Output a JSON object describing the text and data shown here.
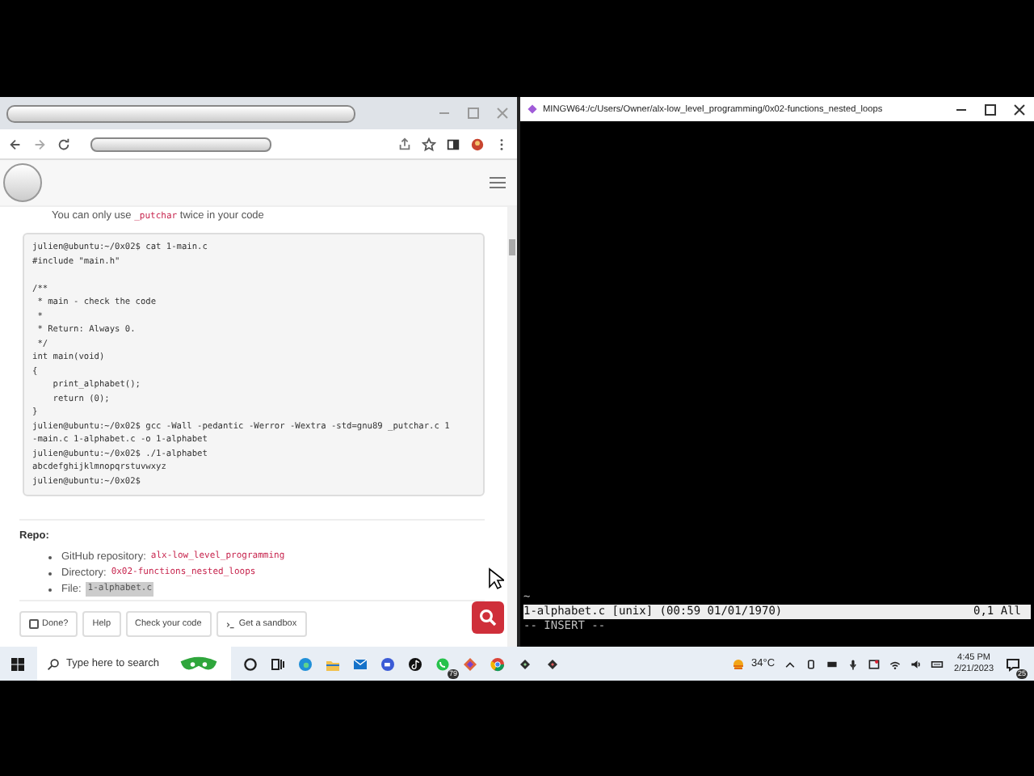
{
  "browser": {
    "bullet": {
      "before": "You can only use ",
      "code": "_putchar",
      "after": " twice in your code"
    },
    "code": "julien@ubuntu:~/0x02$ cat 1-main.c\n#include \"main.h\"\n\n/**\n * main - check the code\n *\n * Return: Always 0.\n */\nint main(void)\n{\n    print_alphabet();\n    return (0);\n}\njulien@ubuntu:~/0x02$ gcc -Wall -pedantic -Werror -Wextra -std=gnu89 _putchar.c 1\n-main.c 1-alphabet.c -o 1-alphabet\njulien@ubuntu:~/0x02$ ./1-alphabet\nabcdefghijklmnopqrstuvwxyz\njulien@ubuntu:~/0x02$",
    "repo_title": "Repo:",
    "repo_items": [
      {
        "label": "GitHub repository:",
        "value": "alx-low_level_programming",
        "kind": "code"
      },
      {
        "label": "Directory:",
        "value": "0x02-functions_nested_loops",
        "kind": "code"
      },
      {
        "label": "File:",
        "value": "1-alphabet.c",
        "kind": "highlight"
      }
    ],
    "done": {
      "label": "Done?",
      "checked": false
    },
    "buttons": [
      {
        "label": "Help",
        "kind": "plain"
      },
      {
        "label": "Check your code",
        "kind": "plain"
      },
      {
        "label": "Get a sandbox",
        "kind": "sandbox"
      }
    ]
  },
  "terminal": {
    "title": "MINGW64:/c/Users/Owner/alx-low_level_programming/0x02-functions_nested_loops",
    "tilde": "~",
    "status_left": "1-alphabet.c [unix] (00:59 01/01/1970)",
    "status_right": "0,1 All",
    "mode": "-- INSERT --"
  },
  "taskbar": {
    "search": {
      "placeholder": "Type here to search"
    },
    "chat_badge": "79",
    "weather": "34°C",
    "time": "4:45 PM",
    "date": "2/21/2023",
    "notification_badge": "25"
  }
}
